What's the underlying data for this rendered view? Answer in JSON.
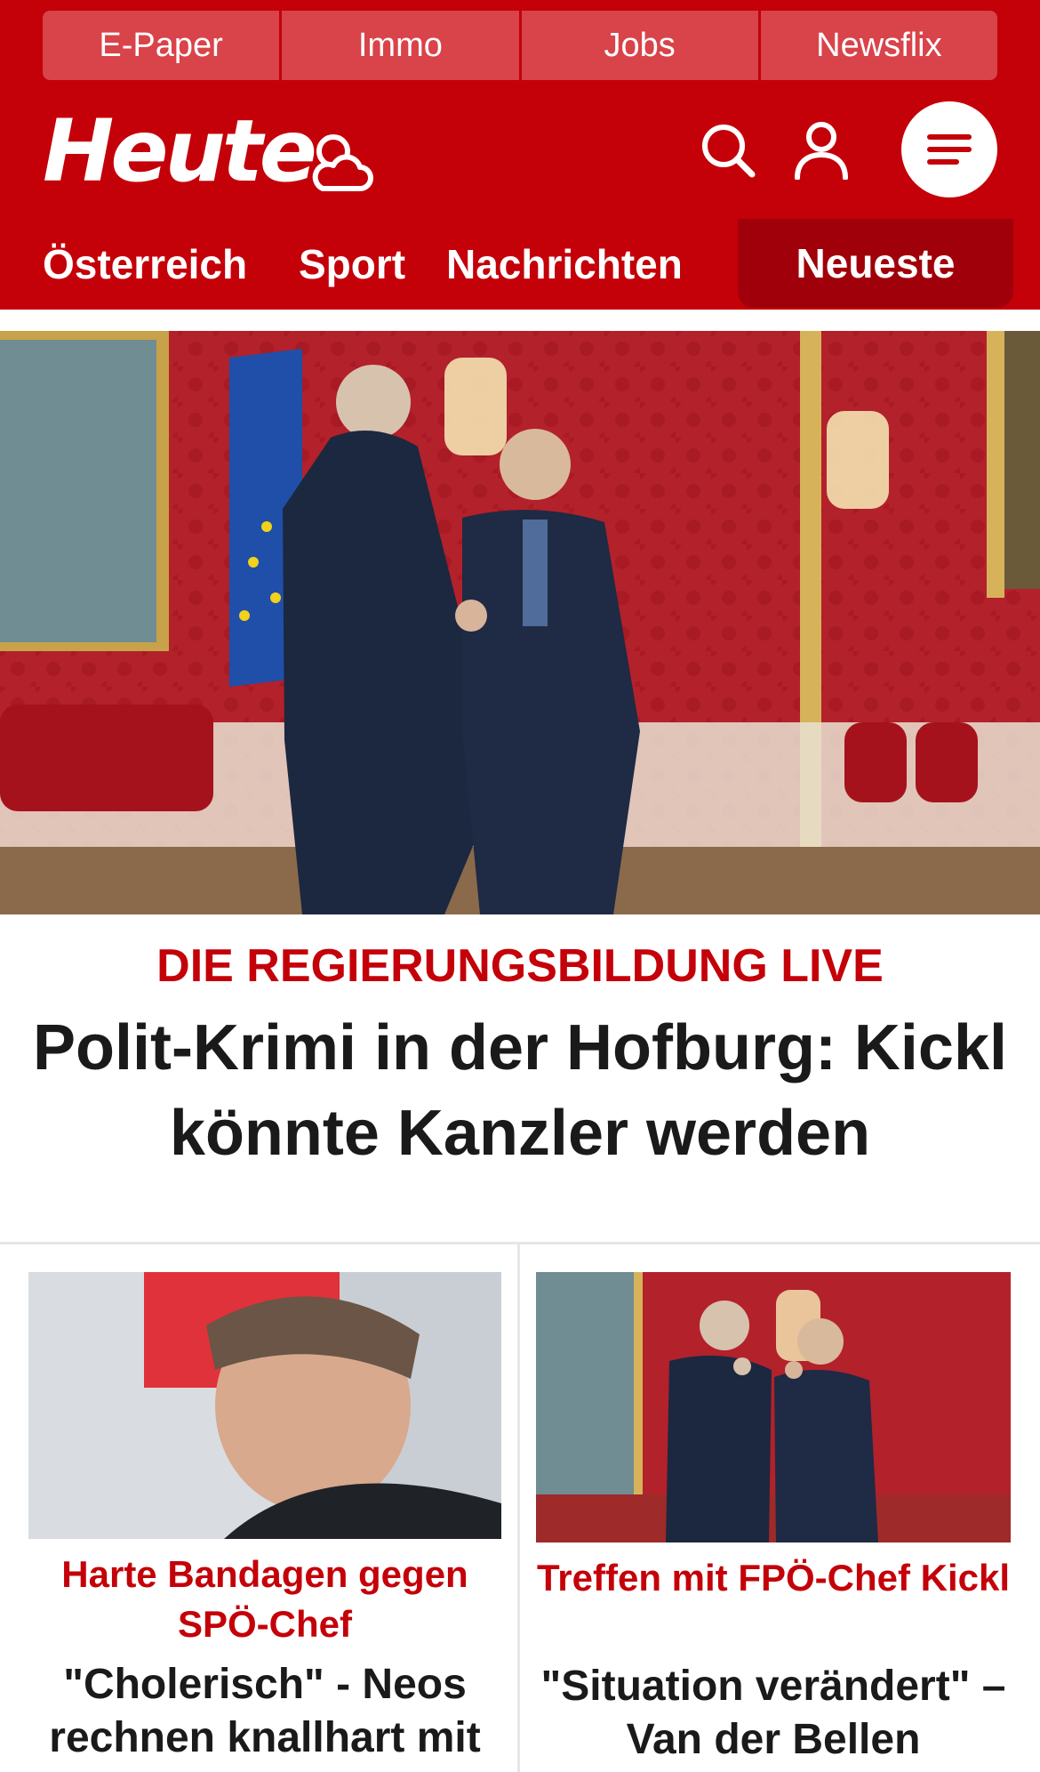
{
  "topbar": {
    "items": [
      "E-Paper",
      "Immo",
      "Jobs",
      "Newsflix"
    ]
  },
  "header": {
    "logo_text": "Heute"
  },
  "nav": {
    "items": [
      "Österreich",
      "Sport",
      "Nachrichten"
    ],
    "highlight": "Neueste"
  },
  "hero": {
    "kicker": "DIE REGIERUNGSBILDUNG LIVE",
    "title": "Polit-Krimi in der Hofburg: Kickl könnte Kanzler werden"
  },
  "cards": [
    {
      "kicker": "Harte Bandagen gegen SPÖ-Chef",
      "title": "\"Cholerisch\" - Neos rechnen knallhart mit"
    },
    {
      "kicker": "Treffen mit FPÖ-Chef Kickl",
      "title": "\"Situation verändert\" – Van der Bellen"
    }
  ],
  "colors": {
    "brand_red": "#c40009",
    "topbar_tab": "#d9434a",
    "nav_active": "#a0000a"
  }
}
